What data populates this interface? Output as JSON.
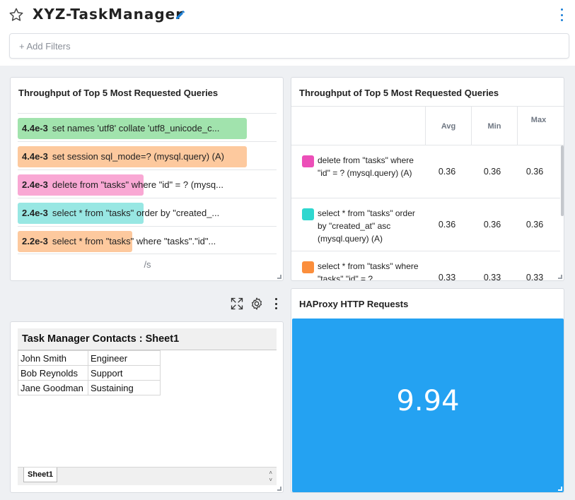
{
  "header": {
    "title": "XYZ-TaskManager",
    "filters_placeholder": "+ Add Filters"
  },
  "colors": {
    "accent": "#1a7fd6",
    "tile_blue": "#24a2f2",
    "green": "#a1e3ad",
    "orange": "#fdc99e",
    "pink": "#f9a8d4",
    "teal": "#98e7e3"
  },
  "throughput_bars": {
    "title": "Throughput of Top 5 Most Requested Queries",
    "unit": "/s",
    "rows": [
      {
        "value": "4.4e-3",
        "label": "set names 'utf8' collate 'utf8_unicode_c...",
        "color": "#a1e3ad",
        "fraction": 1.0
      },
      {
        "value": "4.4e-3",
        "label": "set session sql_mode=? (mysql.query) (A)",
        "color": "#fdc99e",
        "fraction": 1.0
      },
      {
        "value": "2.4e-3",
        "label": "delete from \"tasks\" where \"id\" = ? (mysq...",
        "color": "#f9a8d4",
        "fraction": 0.55
      },
      {
        "value": "2.4e-3",
        "label": "select * from \"tasks\" order by \"created_...",
        "color": "#98e7e3",
        "fraction": 0.55
      },
      {
        "value": "2.2e-3",
        "label": "select * from \"tasks\" where \"tasks\".\"id\"...",
        "color": "#fdc99e",
        "fraction": 0.5
      }
    ]
  },
  "throughput_table": {
    "title": "Throughput of Top 5 Most Requested Queries",
    "columns": [
      "Avg",
      "Min",
      "Max"
    ],
    "rows": [
      {
        "query": "delete from \"tasks\" where \"id\" = ? (mysql.query) (A)",
        "color": "#ec4fb8",
        "avg": "0.36",
        "min": "0.36",
        "max": "0.36"
      },
      {
        "query": "select * from \"tasks\" order by \"created_at\" asc (mysql.query) (A)",
        "color": "#2fd7cf",
        "avg": "0.36",
        "min": "0.36",
        "max": "0.36"
      },
      {
        "query": "select * from \"tasks\" where \"tasks\".\"id\" = ?",
        "color": "#fb8e3c",
        "avg": "0.33",
        "min": "0.33",
        "max": "0.33"
      }
    ]
  },
  "sheet": {
    "title": "Task Manager Contacts : Sheet1",
    "tab": "Sheet1",
    "rows": [
      [
        "John Smith",
        "Engineer"
      ],
      [
        "Bob Reynolds",
        "Support"
      ],
      [
        "Jane Goodman",
        "Sustaining"
      ]
    ]
  },
  "haproxy": {
    "title": "HAProxy HTTP Requests",
    "value": "9.94"
  },
  "icons": [
    "star-icon",
    "pencil-icon",
    "more-vertical-icon",
    "expand-icon",
    "gear-icon",
    "more-vertical-icon"
  ]
}
